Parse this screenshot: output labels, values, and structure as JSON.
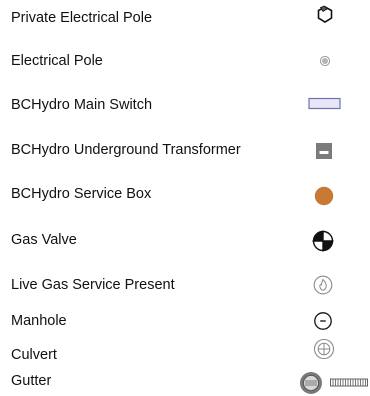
{
  "legend": {
    "items": [
      {
        "label": "Private Electrical Pole",
        "icon": "hexagon-pole-icon"
      },
      {
        "label": "Electrical Pole",
        "icon": "pole-dot-icon"
      },
      {
        "label": "BCHydro Main Switch",
        "icon": "main-switch-rect-icon"
      },
      {
        "label": "BCHydro Underground Transformer",
        "icon": "transformer-square-icon"
      },
      {
        "label": "BCHydro Service Box",
        "icon": "service-box-circle-icon"
      },
      {
        "label": "Gas Valve",
        "icon": "gas-valve-crosshair-icon"
      },
      {
        "label": "Live Gas Service Present",
        "icon": "gas-flame-icon"
      },
      {
        "label": "Manhole",
        "icon": "manhole-circle-icon"
      },
      {
        "label": "Culvert",
        "icon": "culvert-crossed-circle-icon"
      },
      {
        "label": "Gutter",
        "icon": "gutter-drain-icon"
      }
    ]
  },
  "colors": {
    "service_box_fill": "#c87a35",
    "main_switch_fill": "#e6e8f8",
    "main_switch_stroke": "#7272a8",
    "transformer_fill": "#7b7b7b",
    "line_stroke": "#111111",
    "grey_stroke": "#8a8a8a"
  }
}
